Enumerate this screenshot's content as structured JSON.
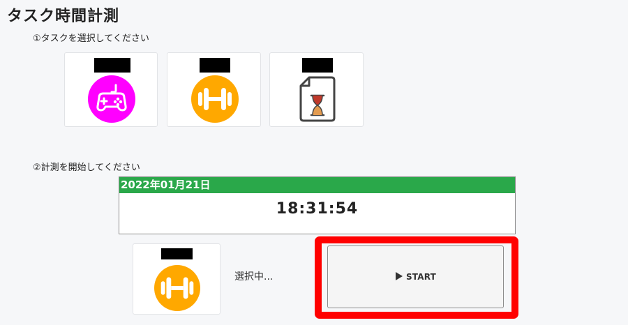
{
  "page": {
    "title": "タスク時間計測"
  },
  "steps": {
    "select_task": "①タスクを選択してください",
    "start_measure": "②計測を開始してください"
  },
  "task_cards": [
    {
      "icon": "gamepad-icon",
      "color": "#ff00ff"
    },
    {
      "icon": "dumbbell-icon",
      "color": "#ffa800"
    },
    {
      "icon": "document-hourglass-icon",
      "color": "#c0392b"
    }
  ],
  "clock": {
    "date": "2022年01月21日",
    "time": "18:31:54",
    "header_color": "#2aa84a"
  },
  "selected_task": {
    "icon": "dumbbell-icon",
    "status": "選択中..."
  },
  "start_button": {
    "icon": "play-icon",
    "label": "START",
    "highlight_color": "#ff0000"
  }
}
